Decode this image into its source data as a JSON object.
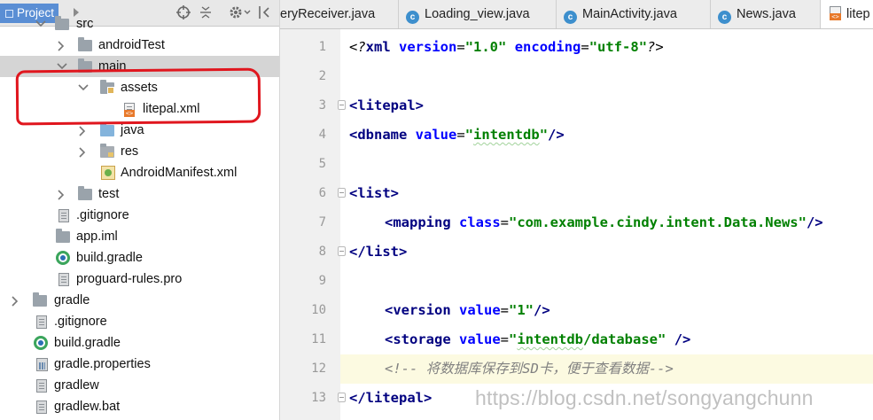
{
  "project_panel": {
    "tab_label": "Project",
    "toolbar_icons": [
      "expand-arrow-icon",
      "locate-icon",
      "collapse-all-icon",
      "gear-icon",
      "hide-panel-icon"
    ],
    "tree": [
      {
        "label": "src",
        "icon": "folder-icon",
        "arrow": "expanded"
      },
      {
        "label": "androidTest",
        "icon": "folder-icon",
        "arrow": "collapsed"
      },
      {
        "label": "main",
        "icon": "folder-icon",
        "arrow": "expanded",
        "selected": true
      },
      {
        "label": "assets",
        "icon": "assets-folder-icon",
        "arrow": "expanded"
      },
      {
        "label": "litepal.xml",
        "icon": "xml-file-icon"
      },
      {
        "label": "java",
        "icon": "source-folder-icon",
        "arrow": "collapsed"
      },
      {
        "label": "res",
        "icon": "resource-folder-icon",
        "arrow": "collapsed"
      },
      {
        "label": "AndroidManifest.xml",
        "icon": "manifest-icon"
      },
      {
        "label": "test",
        "icon": "folder-icon",
        "arrow": "collapsed"
      },
      {
        "label": ".gitignore",
        "icon": "text-file-icon"
      },
      {
        "label": "app.iml",
        "icon": "module-file-icon"
      },
      {
        "label": "build.gradle",
        "icon": "gradle-icon"
      },
      {
        "label": "proguard-rules.pro",
        "icon": "text-file-icon"
      },
      {
        "label": "gradle",
        "icon": "folder-icon",
        "arrow": "collapsed"
      },
      {
        "label": ".gitignore",
        "icon": "text-file-icon"
      },
      {
        "label": "build.gradle",
        "icon": "gradle-icon"
      },
      {
        "label": "gradle.properties",
        "icon": "properties-file-icon"
      },
      {
        "label": "gradlew",
        "icon": "text-file-icon"
      },
      {
        "label": "gradlew.bat",
        "icon": "text-file-icon"
      }
    ],
    "annotation_color": "#e0161e"
  },
  "editor": {
    "tabs": [
      {
        "label": "eryReceiver.java",
        "icon": "java-class-icon"
      },
      {
        "label": "Loading_view.java",
        "icon": "java-class-icon"
      },
      {
        "label": "MainActivity.java",
        "icon": "java-class-icon"
      },
      {
        "label": "News.java",
        "icon": "java-class-icon"
      },
      {
        "label": "litep",
        "icon": "xml-file-icon",
        "active": true
      }
    ],
    "highlighted_line": 12,
    "lines": [
      {
        "num": "1"
      },
      {
        "num": "2"
      },
      {
        "num": "3"
      },
      {
        "num": "4"
      },
      {
        "num": "5"
      },
      {
        "num": "6"
      },
      {
        "num": "7"
      },
      {
        "num": "8"
      },
      {
        "num": "9"
      },
      {
        "num": "10"
      },
      {
        "num": "11"
      },
      {
        "num": "12"
      },
      {
        "num": "13"
      }
    ],
    "code": {
      "l1": {
        "open": "<?",
        "name": "xml",
        "a1": "version",
        "eq1": "=",
        "v1": "\"1.0\"",
        "a2": "encoding",
        "eq2": "=",
        "v2": "\"utf-8\"",
        "close": "?>"
      },
      "l3": {
        "tag": "<litepal>"
      },
      "l4": {
        "open": "<dbname",
        "a1": "value",
        "eq": "=",
        "q1": "\"",
        "v1": "intentdb",
        "q2": "\"",
        "close": "/>"
      },
      "l6": {
        "tag": "<list>"
      },
      "l7": {
        "open": "<mapping",
        "a1": "class",
        "eq": "=",
        "v1": "\"com.example.cindy.intent.Data.News\"",
        "close": "/>"
      },
      "l8": {
        "tag": "</list>"
      },
      "l10": {
        "open": "<version",
        "a1": "value",
        "eq": "=",
        "v1": "\"1\"",
        "close": "/>"
      },
      "l11": {
        "open": "<storage",
        "a1": "value",
        "eq": "=",
        "q1": "\"",
        "v1": "intentdb",
        "v2": "/database",
        "q2": "\"",
        "close": " />"
      },
      "l12": {
        "comment": "<!-- 将数据库保存到SD卡，便于查看数据-->"
      },
      "l13": {
        "tag": "</litepal>"
      }
    },
    "syntax_colors": {
      "tag": "#000080",
      "attribute": "#0000ff",
      "value": "#008000",
      "comment": "#808080",
      "highlight": "#fcfae1"
    }
  },
  "watermark": "https://blog.csdn.net/songyangchunn"
}
